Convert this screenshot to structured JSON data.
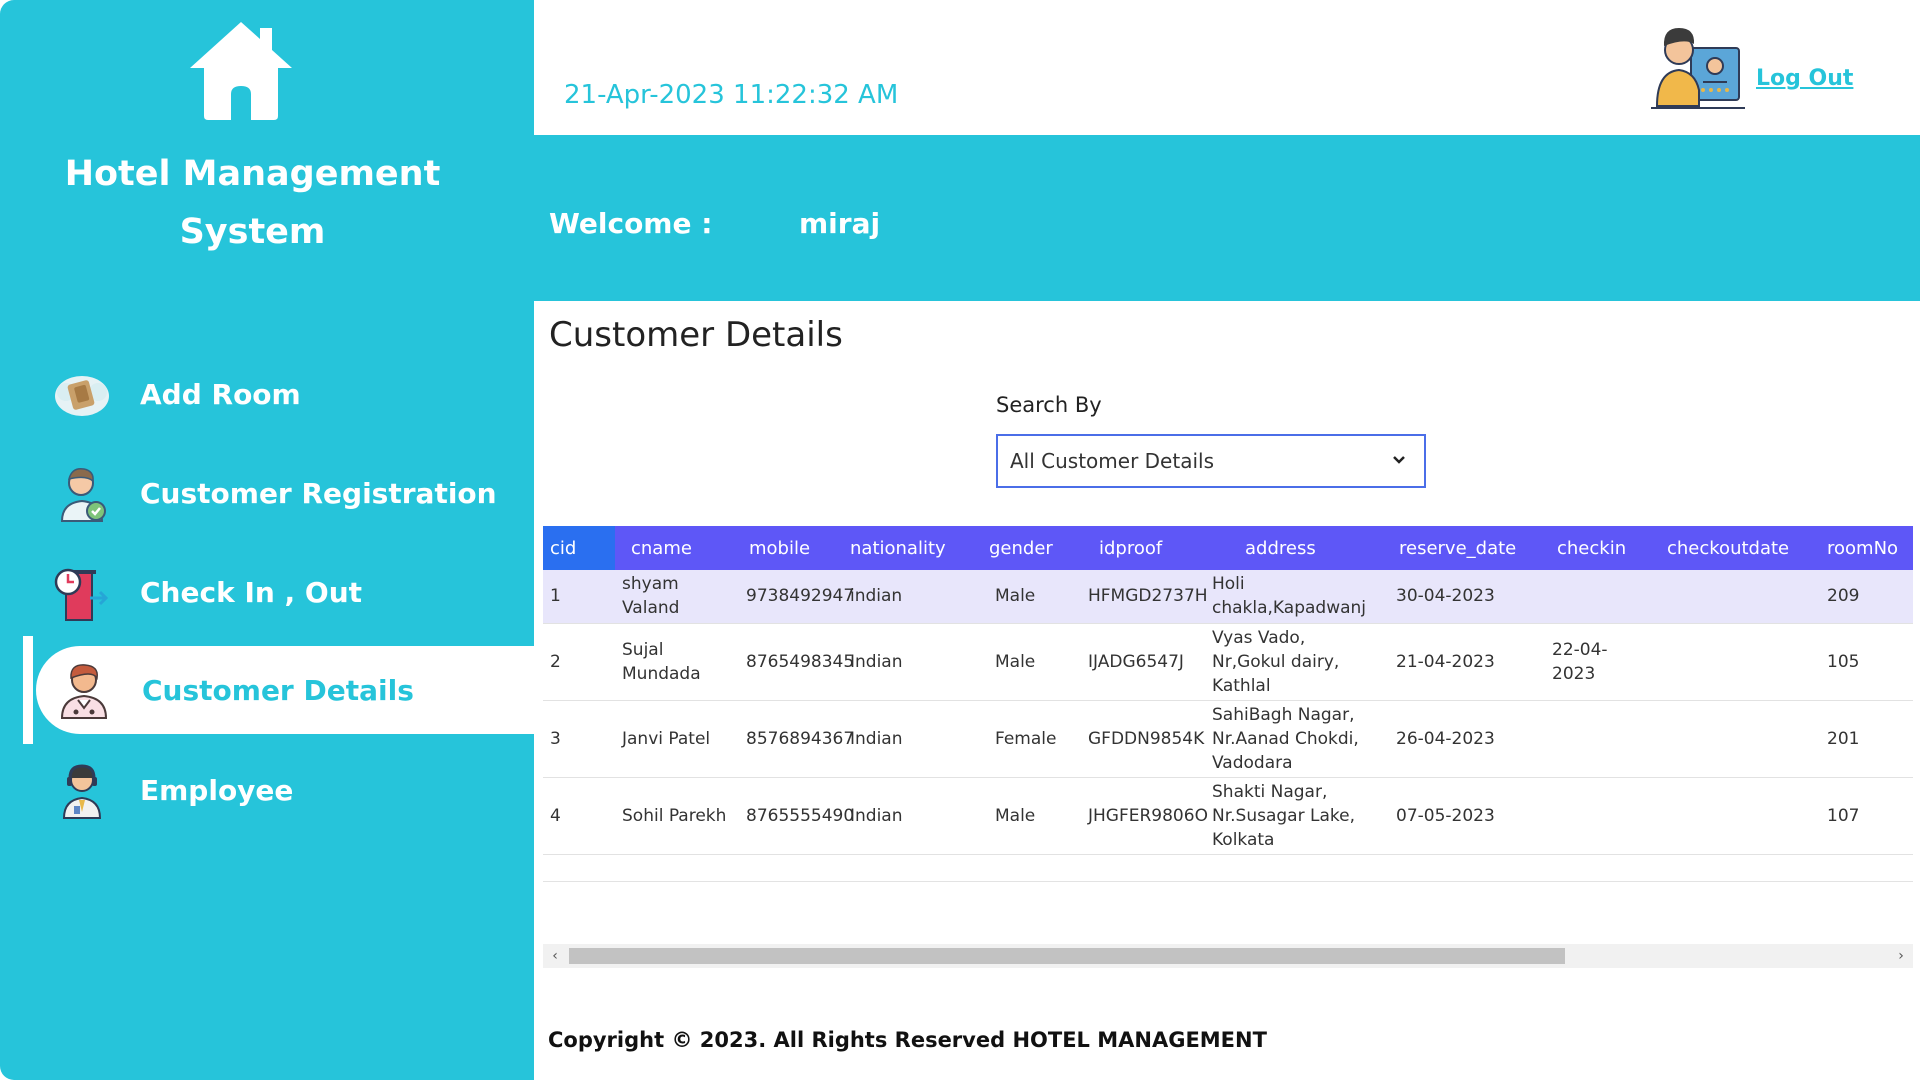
{
  "sidebar": {
    "title": "Hotel Management System",
    "items": [
      {
        "label": "Add Room"
      },
      {
        "label": "Customer Registration"
      },
      {
        "label": "Check In , Out"
      },
      {
        "label": "Customer Details"
      },
      {
        "label": "Employee"
      }
    ],
    "active_index": 3
  },
  "header": {
    "datetime": "21-Apr-2023 11:22:32 AM",
    "logout_label": "Log Out",
    "welcome_label": "Welcome :",
    "username": "miraj"
  },
  "main": {
    "title": "Customer Details",
    "search_label": "Search By",
    "search_value": "All Customer Details",
    "table": {
      "columns": [
        "cid",
        "cname",
        "mobile",
        "nationality",
        "gender",
        "idproof",
        "address",
        "reserve_date",
        "checkin",
        "checkoutdate",
        "roomNo"
      ],
      "rows": [
        [
          "1",
          "shyam Valand",
          "9738492947",
          "indian",
          "Male",
          "HFMGD2737H",
          "Holi chakla,Kapadwanj",
          "30-04-2023",
          "",
          "",
          "209"
        ],
        [
          "2",
          "Sujal Mundada",
          "8765498345",
          "Indian",
          "Male",
          "IJADG6547J",
          "Vyas Vado, Nr,Gokul dairy, Kathlal",
          "21-04-2023",
          "22-04-2023",
          "",
          "105"
        ],
        [
          "3",
          "Janvi Patel",
          "8576894367",
          "Indian",
          "Female",
          "GFDDN9854K",
          "SahiBagh Nagar, Nr.Aanad Chokdi, Vadodara",
          "26-04-2023",
          "",
          "",
          "201"
        ],
        [
          "4",
          "Sohil Parekh",
          "8765555490",
          "Indian",
          "Male",
          "JHGFER9806O",
          "Shakti Nagar, Nr.Susagar Lake, Kolkata",
          "07-05-2023",
          "",
          "",
          "107"
        ]
      ]
    }
  },
  "footer": {
    "text": "Copyright © 2023. All Rights Reserved HOTEL MANAGEMENT"
  },
  "colors": {
    "accent": "#26c4da",
    "table_header": "#5e57f7",
    "table_header_first": "#2a6ff0",
    "row_highlight": "#e8e6fb"
  },
  "icons": [
    "home-icon",
    "room-icon",
    "customer-registration-icon",
    "check-in-out-icon",
    "customer-details-icon",
    "employee-icon",
    "user-avatar-icon",
    "chevron-down-icon"
  ]
}
